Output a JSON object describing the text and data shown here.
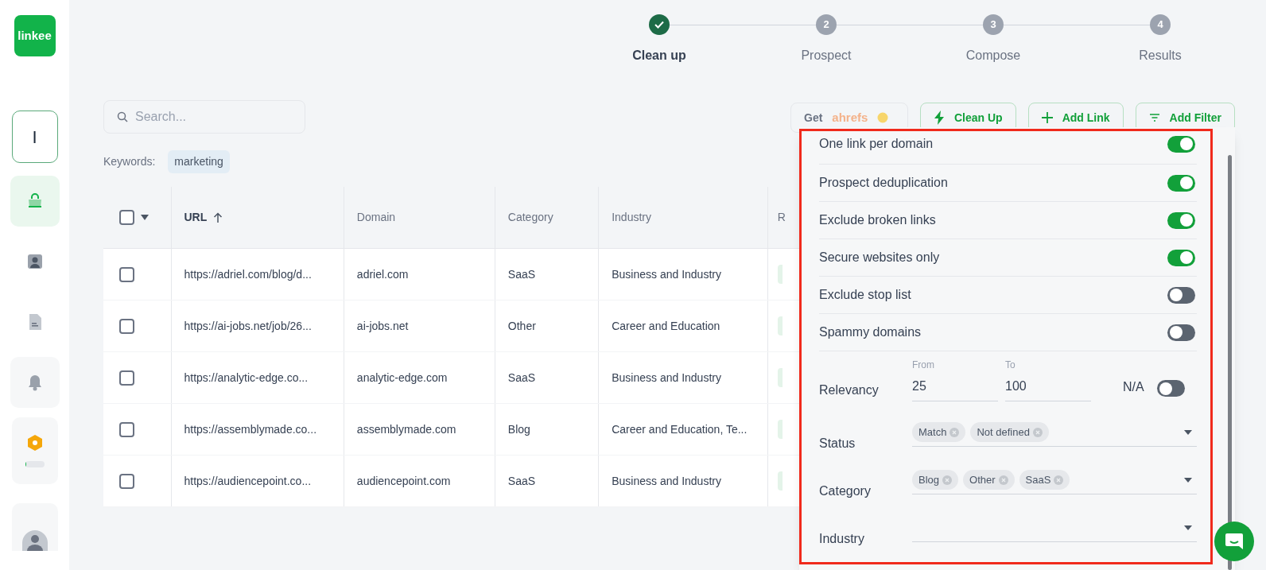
{
  "sidebar": {
    "logo": "linkee",
    "items": [
      {
        "kind": "letter",
        "text": "I",
        "selected": false
      },
      {
        "kind": "bag",
        "selected": true
      },
      {
        "kind": "person",
        "selected": false
      },
      {
        "kind": "document",
        "selected": false
      },
      {
        "kind": "bell",
        "selected": false
      },
      {
        "kind": "credits",
        "selected": false,
        "level": 0.06
      },
      {
        "kind": "avatar",
        "selected": false
      }
    ]
  },
  "stepper": [
    {
      "label": "Clean up",
      "completed": true
    },
    {
      "number": "2",
      "label": "Prospect",
      "completed": false
    },
    {
      "number": "3",
      "label": "Compose",
      "completed": false
    },
    {
      "number": "4",
      "label": "Results",
      "completed": false
    }
  ],
  "search": {
    "placeholder": "Search..."
  },
  "keywords": {
    "label": "Keywords:",
    "tags": [
      "marketing"
    ]
  },
  "toolbar": [
    {
      "kind": "ahrefs",
      "label": "Get",
      "brand": "ahrefs",
      "disabled": true
    },
    {
      "kind": "bolt",
      "label": "Clean Up",
      "disabled": false
    },
    {
      "kind": "plus",
      "label": "Add Link",
      "disabled": false
    },
    {
      "kind": "filter",
      "label": "Add Filter",
      "disabled": false
    }
  ],
  "table": {
    "all_checked": false,
    "columns": [
      {
        "label": "URL",
        "sorted": true
      },
      {
        "label": "Domain",
        "sorted": false
      },
      {
        "label": "Category",
        "sorted": false
      },
      {
        "label": "Industry",
        "sorted": false
      },
      {
        "label": "R",
        "sorted": false
      }
    ],
    "rows": [
      {
        "checked": false,
        "cells": [
          "https://adriel.com/blog/d...",
          "adriel.com",
          "SaaS",
          "Business and Industry"
        ]
      },
      {
        "checked": false,
        "cells": [
          "https://ai-jobs.net/job/26...",
          "ai-jobs.net",
          "Other",
          "Career and Education"
        ]
      },
      {
        "checked": false,
        "cells": [
          "https://analytic-edge.co...",
          "analytic-edge.com",
          "SaaS",
          "Business and Industry"
        ]
      },
      {
        "checked": false,
        "cells": [
          "https://assemblymade.co...",
          "assemblymade.com",
          "Blog",
          "Career and Education, Te..."
        ]
      },
      {
        "checked": false,
        "cells": [
          "https://audiencepoint.co...",
          "audiencepoint.com",
          "SaaS",
          "Business and Industry"
        ]
      }
    ]
  },
  "filter_panel": {
    "highlighted": true,
    "filters": [
      {
        "kind": "toggle",
        "label": "One link per domain",
        "on": true
      },
      {
        "kind": "toggle",
        "label": "Prospect deduplication",
        "on": true
      },
      {
        "kind": "toggle",
        "label": "Exclude broken links",
        "on": true
      },
      {
        "kind": "toggle",
        "label": "Secure websites only",
        "on": true
      },
      {
        "kind": "toggle",
        "label": "Exclude stop list",
        "on": false
      },
      {
        "kind": "toggle",
        "label": "Spammy domains",
        "on": false
      },
      {
        "kind": "range",
        "label": "Relevancy",
        "from_label": "From",
        "from": "25",
        "to_label": "To",
        "to": "100",
        "na_label": "N/A",
        "on": false
      },
      {
        "kind": "select",
        "label": "Status",
        "chips": [
          "Match",
          "Not defined"
        ]
      },
      {
        "kind": "select",
        "label": "Category",
        "chips": [
          "Blog",
          "Other",
          "SaaS"
        ]
      },
      {
        "kind": "select",
        "label": "Industry"
      }
    ]
  }
}
